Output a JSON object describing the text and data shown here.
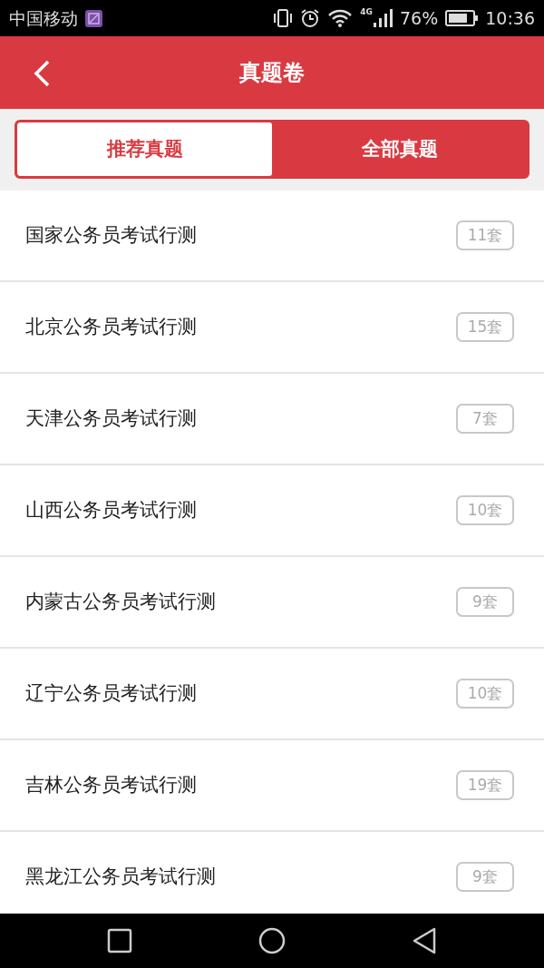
{
  "status_bar": {
    "carrier": "中国移动",
    "network": "4G",
    "battery": "76%",
    "time": "10:36"
  },
  "header": {
    "title": "真题卷"
  },
  "tabs": [
    {
      "label": "推荐真题",
      "selected": true
    },
    {
      "label": "全部真题",
      "selected": false
    }
  ],
  "papers": [
    {
      "title": "国家公务员考试行测",
      "count": "11套"
    },
    {
      "title": "北京公务员考试行测",
      "count": "15套"
    },
    {
      "title": "天津公务员考试行测",
      "count": "7套"
    },
    {
      "title": "山西公务员考试行测",
      "count": "10套"
    },
    {
      "title": "内蒙古公务员考试行测",
      "count": "9套"
    },
    {
      "title": "辽宁公务员考试行测",
      "count": "10套"
    },
    {
      "title": "吉林公务员考试行测",
      "count": "19套"
    },
    {
      "title": "黑龙江公务员考试行测",
      "count": "9套"
    }
  ]
}
